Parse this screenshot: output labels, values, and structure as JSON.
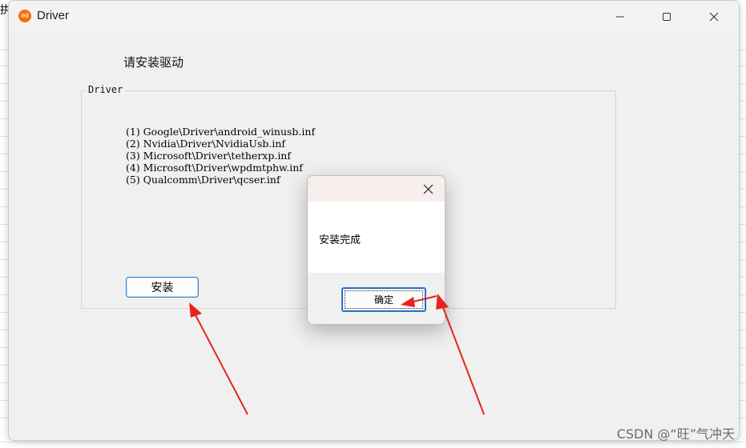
{
  "window": {
    "title": "Driver",
    "app_icon_label": "mi",
    "controls": {
      "minimize": "minimize-icon",
      "maximize": "maximize-icon",
      "close": "close-icon"
    }
  },
  "main": {
    "instruction": "请安装驱动",
    "group_label": "Driver",
    "drivers": [
      "(1) Google\\Driver\\android_winusb.inf",
      "(2) Nvidia\\Driver\\NvidiaUsb.inf",
      "(3) Microsoft\\Driver\\tetherxp.inf",
      "(4) Microsoft\\Driver\\wpdmtphw.inf",
      "(5) Qualcomm\\Driver\\qcser.inf"
    ],
    "install_button": "安装"
  },
  "dialog": {
    "message": "安装完成",
    "ok_button": "确定"
  },
  "background": {
    "partial_glyph": "拱"
  },
  "annotation": {
    "arrow_color": "#e8231d"
  },
  "watermark": "CSDN @“旺”气冲天"
}
